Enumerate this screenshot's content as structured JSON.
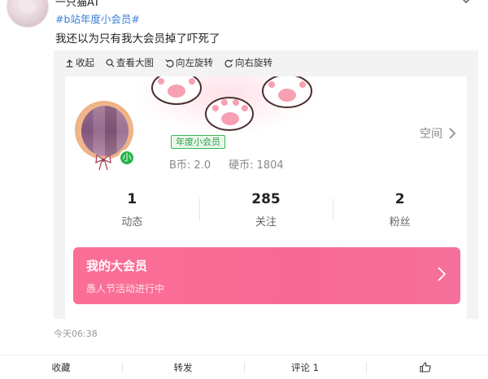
{
  "post": {
    "username": "一只猫AT",
    "topic": "#b站年度小会员#",
    "text": "我还以为只有我大会员掉了吓死了",
    "time": "今天06:38"
  },
  "toolbar": {
    "collapse": "收起",
    "view_large": "查看大图",
    "rotate_left": "向左旋转",
    "rotate_right": "向右旋转"
  },
  "profile": {
    "level_badge": "小",
    "vip_tag": "年度小会员",
    "b_coins": "B币: 2.0",
    "hard_coins": "硬币: 1804",
    "space_link": "空间",
    "stats": [
      {
        "value": "1",
        "label": "动态"
      },
      {
        "value": "285",
        "label": "关注"
      },
      {
        "value": "2",
        "label": "粉丝"
      }
    ],
    "vip_banner": {
      "title": "我的大会员",
      "subtitle": "愚人节活动进行中"
    }
  },
  "actions": {
    "favorite": "收藏",
    "repost": "转发",
    "comment": "评论 1"
  },
  "colors": {
    "topic_link": "#3a7fd4",
    "vip_green": "#2e9f4a",
    "banner_pink": "#fb6f97"
  }
}
